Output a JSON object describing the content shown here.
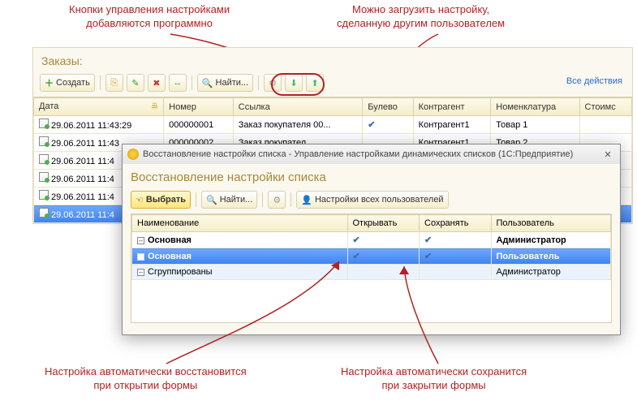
{
  "annotations": {
    "topLeft": "Кнопки управления настройками\nдобавляются программно",
    "topRight": "Можно загрузить настройку,\nсделанную другим пользователем",
    "bottomLeft": "Настройка автоматически восстановится\nпри открытии формы",
    "bottomRight": "Настройка автоматически сохранится\nпри закрытии формы"
  },
  "main": {
    "title": "Заказы:",
    "toolbar": {
      "create": "Создать",
      "find": "Найти...",
      "allActions": "Все действия"
    },
    "columns": [
      "Дата",
      "Номер",
      "Ссылка",
      "Булево",
      "Контрагент",
      "Номенклатура",
      "Стоимс"
    ],
    "rows": [
      {
        "date": "29.06.2011 11:43:29",
        "num": "000000001",
        "ref": "Заказ покупателя 00...",
        "bool": true,
        "agent": "Контрагент1",
        "item": "Товар 1"
      },
      {
        "date": "29.06.2011 11:43",
        "num": "000000002",
        "ref": "Заказ покупател",
        "bool": false,
        "agent": "Контрагент1",
        "item": "Товар 2"
      },
      {
        "date": "29.06.2011 11:4",
        "num": "",
        "ref": "",
        "bool": false,
        "agent": "",
        "item": ""
      },
      {
        "date": "29.06.2011 11:4",
        "num": "",
        "ref": "",
        "bool": false,
        "agent": "",
        "item": ""
      },
      {
        "date": "29.06.2011 11:4",
        "num": "",
        "ref": "",
        "bool": false,
        "agent": "",
        "item": ""
      },
      {
        "date": "29.06.2011 11:4",
        "num": "",
        "ref": "",
        "bool": false,
        "agent": "",
        "item": "",
        "selected": true
      }
    ]
  },
  "dialog": {
    "windowTitle": "Восстановление настройки списка - Управление настройками динамических списков  (1С:Предприятие)",
    "heading": "Восстановление настройки списка",
    "toolbar": {
      "select": "Выбрать",
      "find": "Найти...",
      "allUsers": "Настройки всех пользователей"
    },
    "columns": [
      "Наименование",
      "Открывать",
      "Сохранять",
      "Пользователь"
    ],
    "rows": [
      {
        "name": "Основная",
        "open": true,
        "save": true,
        "user": "Администратор",
        "bold": true
      },
      {
        "name": "Основная",
        "open": true,
        "save": true,
        "user": "Пользователь",
        "bold": true,
        "selected": true
      },
      {
        "name": "Сгруппированы",
        "open": false,
        "save": false,
        "user": "Администратор",
        "highlight": true
      }
    ]
  }
}
